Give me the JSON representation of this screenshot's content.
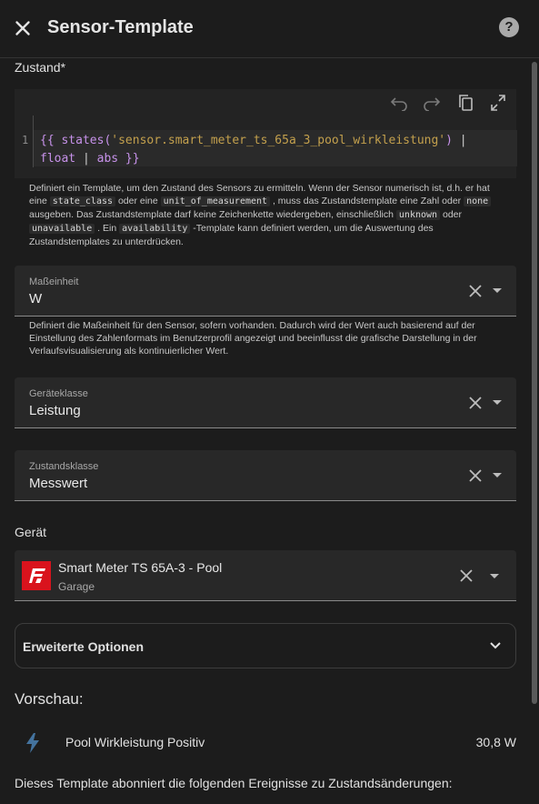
{
  "header": {
    "title": "Sensor-Template",
    "help_label": "?"
  },
  "state": {
    "label": "Zustand*",
    "line_number": "1",
    "code_parts": [
      "{{ ",
      "states(",
      "'sensor.smart_meter_ts_65a_3_pool_wirkleistung'",
      ") ",
      "|",
      "float",
      " | ",
      "abs",
      " }}"
    ],
    "help": {
      "t1": "Definiert ein Template, um den Zustand des Sensors zu ermitteln. Wenn der Sensor numerisch ist, d.h. er hat eine",
      "c1": "state_class",
      "t2": "oder eine",
      "c2": "unit_of_measurement",
      "t3": ", muss das Zustandstemplate eine Zahl oder",
      "c3": "none",
      "t4": "ausgeben. Das Zustandstemplate darf keine Zeichenkette wiedergeben, einschließlich",
      "c4": "unknown",
      "t5": "oder",
      "c5": "unavailable",
      "t6": ". Ein",
      "c6": "availability",
      "t7": "-Template kann definiert werden, um die Auswertung des Zustandstemplates zu unterdrücken."
    }
  },
  "unit": {
    "label": "Maßeinheit",
    "value": "W",
    "help": "Definiert die Maßeinheit für den Sensor, sofern vorhanden. Dadurch wird der Wert auch basierend auf der Einstellung des Zahlenformats im Benutzerprofil angezeigt und beeinflusst die grafische Darstellung in der Verlaufsvisualisierung als kontinuierlicher Wert."
  },
  "device_class": {
    "label": "Geräteklasse",
    "value": "Leistung"
  },
  "state_class": {
    "label": "Zustandsklasse",
    "value": "Messwert"
  },
  "device": {
    "section_label": "Gerät",
    "name": "Smart Meter TS 65A-3 - Pool",
    "area": "Garage"
  },
  "advanced": {
    "label": "Erweiterte Optionen"
  },
  "preview": {
    "title": "Vorschau:",
    "entity_name": "Pool Wirkleistung Positiv",
    "entity_state": "30,8 W",
    "subscribe_text": "Dieses Template abonniert die folgenden Ereignisse zu Zustandsänderungen:"
  },
  "colors": {
    "background": "#1c1c1c",
    "field": "#282828",
    "brand_logo": "#d9131d",
    "icon_blue": "#44739e"
  },
  "icons": {
    "close": "close-icon",
    "help": "help-icon",
    "undo": "undo-icon",
    "redo": "redo-icon",
    "copy": "copy-icon",
    "fullscreen": "fullscreen-icon",
    "clear": "clear-icon",
    "caret": "caret-down-icon",
    "chevron": "chevron-down-icon",
    "bolt": "lightning-bolt-icon"
  }
}
